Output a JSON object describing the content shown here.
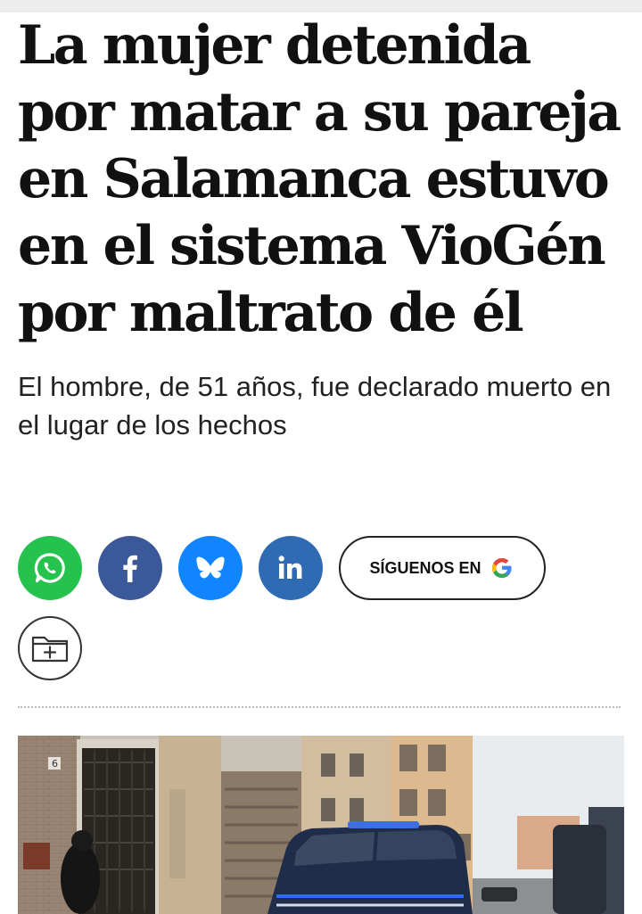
{
  "article": {
    "headline": "La mujer detenida por matar a su pareja en Salamanca estuvo en el sistema VioGén por maltrato de él",
    "subheadline": "El hombre, de 51 años, fue declarado muerto en el lugar de los hechos"
  },
  "share": {
    "buttons": [
      {
        "network": "WhatsApp",
        "icon": "whatsapp-icon",
        "color": "#25c24e"
      },
      {
        "network": "Facebook",
        "icon": "facebook-icon",
        "color": "#3b5998"
      },
      {
        "network": "Bluesky",
        "icon": "bluesky-icon",
        "color": "#1185fe"
      },
      {
        "network": "LinkedIn",
        "icon": "linkedin-icon",
        "color": "#2f6bb3"
      }
    ],
    "follow_label": "SÍGUENOS EN",
    "follow_icon": "google-icon",
    "save_icon": "folder-plus-icon"
  },
  "photo": {
    "house_number": "6"
  }
}
